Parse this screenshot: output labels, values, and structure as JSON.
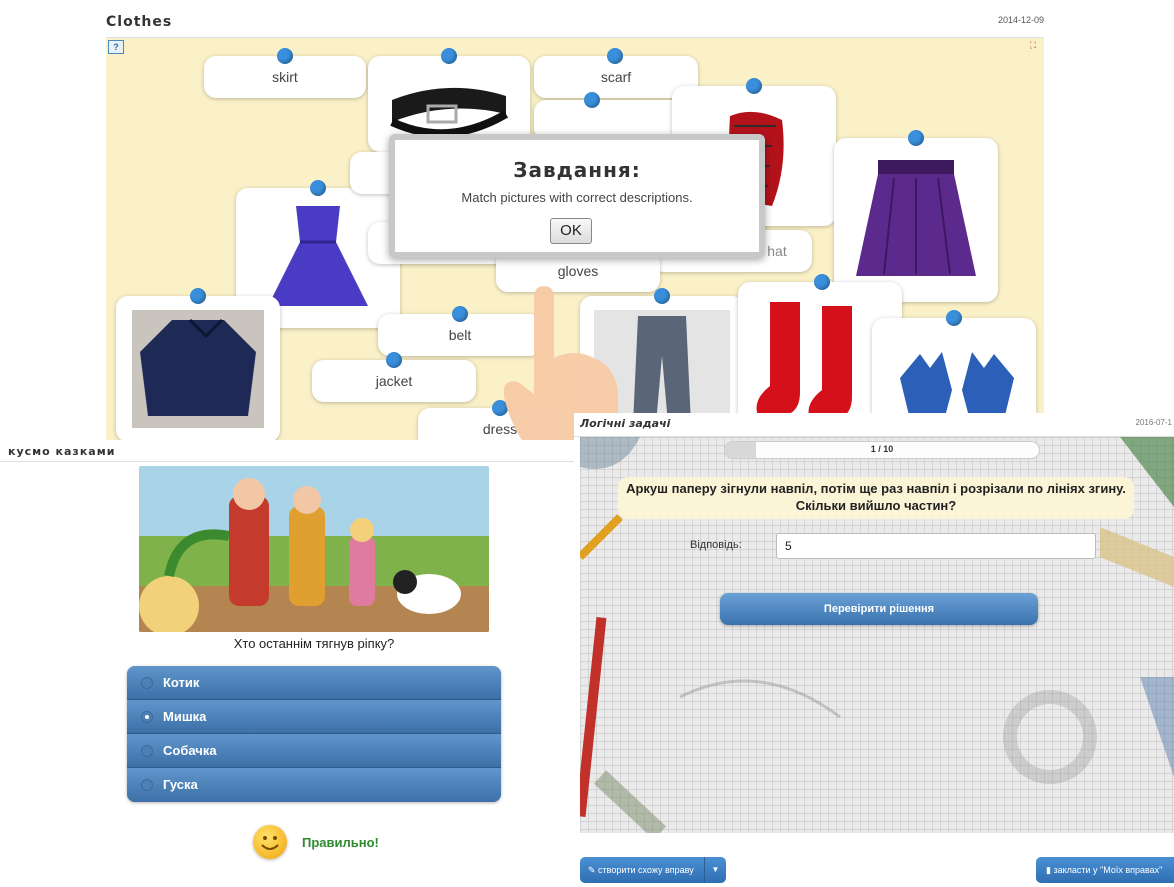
{
  "clothes": {
    "title": "Clothes",
    "date": "2014-12-09",
    "help_icon": "help-question-icon",
    "fullscreen_icon": "fullscreen-icon",
    "labels": {
      "skirt": "skirt",
      "scarf": "scarf",
      "hat": "hat",
      "gloves": "gloves",
      "belt": "belt",
      "jacket": "jacket",
      "dress": "dress"
    },
    "dialog": {
      "title": "Завдання:",
      "text": "Match pictures with correct descriptions.",
      "ok": "OK"
    }
  },
  "tale": {
    "title": "кусмо казками",
    "question": "Хто останнім тягнув ріпку?",
    "options": [
      "Котик",
      "Мишка",
      "Собачка",
      "Гуска"
    ],
    "selected_index": 1,
    "result": "Правильно!"
  },
  "logic": {
    "title": "Логічні задачі",
    "date": "2016-07-1",
    "progress": "1 / 10",
    "progress_fraction": 0.1,
    "question_line1": "Аркуш паперу зігнули навпіл, потім ще раз навпіл і розрізали по лініях згину.",
    "question_line2": "Скільки вийшло частин?",
    "answer_label": "Відповідь:",
    "answer_value": "5",
    "check_button": "Перевірити рішення",
    "create_button": "створити схожу вправу",
    "save_button": "закласти у \"Моїх вправах\""
  }
}
